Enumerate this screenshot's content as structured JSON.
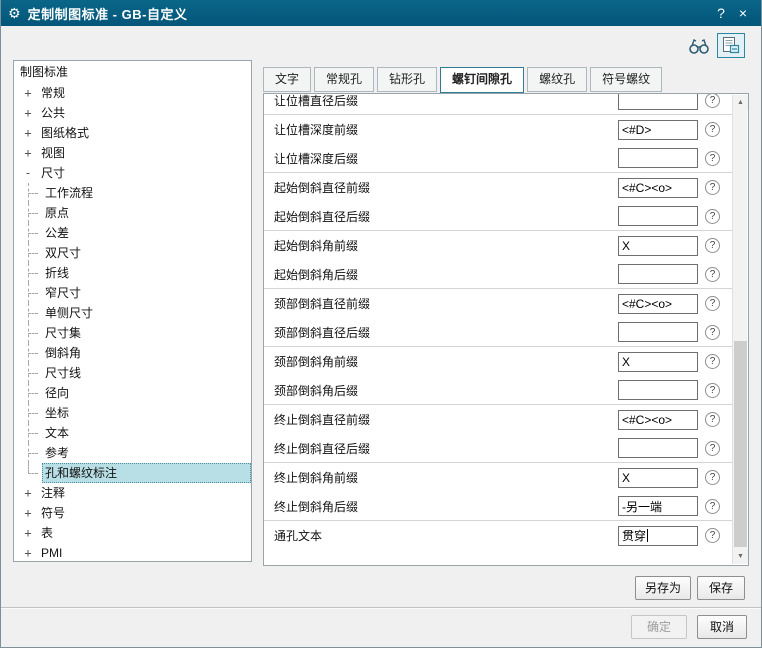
{
  "window": {
    "title": "定制制图标准 - GB-自定义",
    "help_label": "?",
    "close_label": "×"
  },
  "tree": {
    "header": "制图标准",
    "items": [
      {
        "label": "常规",
        "level": 0,
        "expander": "+"
      },
      {
        "label": "公共",
        "level": 0,
        "expander": "+"
      },
      {
        "label": "图纸格式",
        "level": 0,
        "expander": "+"
      },
      {
        "label": "视图",
        "level": 0,
        "expander": "+"
      },
      {
        "label": "尺寸",
        "level": 0,
        "expander": "-"
      },
      {
        "label": "工作流程",
        "level": 1
      },
      {
        "label": "原点",
        "level": 1
      },
      {
        "label": "公差",
        "level": 1
      },
      {
        "label": "双尺寸",
        "level": 1
      },
      {
        "label": "折线",
        "level": 1
      },
      {
        "label": "窄尺寸",
        "level": 1
      },
      {
        "label": "单侧尺寸",
        "level": 1
      },
      {
        "label": "尺寸集",
        "level": 1
      },
      {
        "label": "倒斜角",
        "level": 1
      },
      {
        "label": "尺寸线",
        "level": 1
      },
      {
        "label": "径向",
        "level": 1
      },
      {
        "label": "坐标",
        "level": 1
      },
      {
        "label": "文本",
        "level": 1
      },
      {
        "label": "参考",
        "level": 1
      },
      {
        "label": "孔和螺纹标注",
        "level": 1,
        "selected": true
      },
      {
        "label": "注释",
        "level": 0,
        "expander": "+"
      },
      {
        "label": "符号",
        "level": 0,
        "expander": "+"
      },
      {
        "label": "表",
        "level": 0,
        "expander": "+"
      },
      {
        "label": "PMI",
        "level": 0,
        "expander": "+"
      }
    ]
  },
  "tabs": {
    "items": [
      "文字",
      "常规孔",
      "钻形孔",
      "螺钉间隙孔",
      "螺纹孔",
      "符号螺纹"
    ],
    "active_index": 3
  },
  "form": {
    "help_glyph": "?",
    "rows": [
      {
        "label": "让位槽直径后缀",
        "value": "",
        "clipped": true,
        "group_end": true
      },
      {
        "label": "让位槽深度前缀",
        "value": "<#D>"
      },
      {
        "label": "让位槽深度后缀",
        "value": "",
        "group_end": true
      },
      {
        "label": "起始倒斜直径前缀",
        "value": "<#C><o>"
      },
      {
        "label": "起始倒斜直径后缀",
        "value": "",
        "group_end": true
      },
      {
        "label": "起始倒斜角前缀",
        "value": "X"
      },
      {
        "label": "起始倒斜角后缀",
        "value": "",
        "group_end": true
      },
      {
        "label": "颈部倒斜直径前缀",
        "value": "<#C><o>"
      },
      {
        "label": "颈部倒斜直径后缀",
        "value": "",
        "group_end": true
      },
      {
        "label": "颈部倒斜角前缀",
        "value": "X"
      },
      {
        "label": "颈部倒斜角后缀",
        "value": "",
        "group_end": true
      },
      {
        "label": "终止倒斜直径前缀",
        "value": "<#C><o>"
      },
      {
        "label": "终止倒斜直径后缀",
        "value": "",
        "group_end": true
      },
      {
        "label": "终止倒斜角前缀",
        "value": "X"
      },
      {
        "label": "终止倒斜角后缀",
        "value": "-另一端",
        "group_end": true
      },
      {
        "label": "通孔文本",
        "value": "贯穿",
        "focused": true
      }
    ]
  },
  "buttons": {
    "save_as": "另存为",
    "save": "保存",
    "ok": "确定",
    "cancel": "取消"
  },
  "colors": {
    "titlebar": "#02567a",
    "accent": "#2e86a5",
    "selection": "#b9dfe6"
  }
}
